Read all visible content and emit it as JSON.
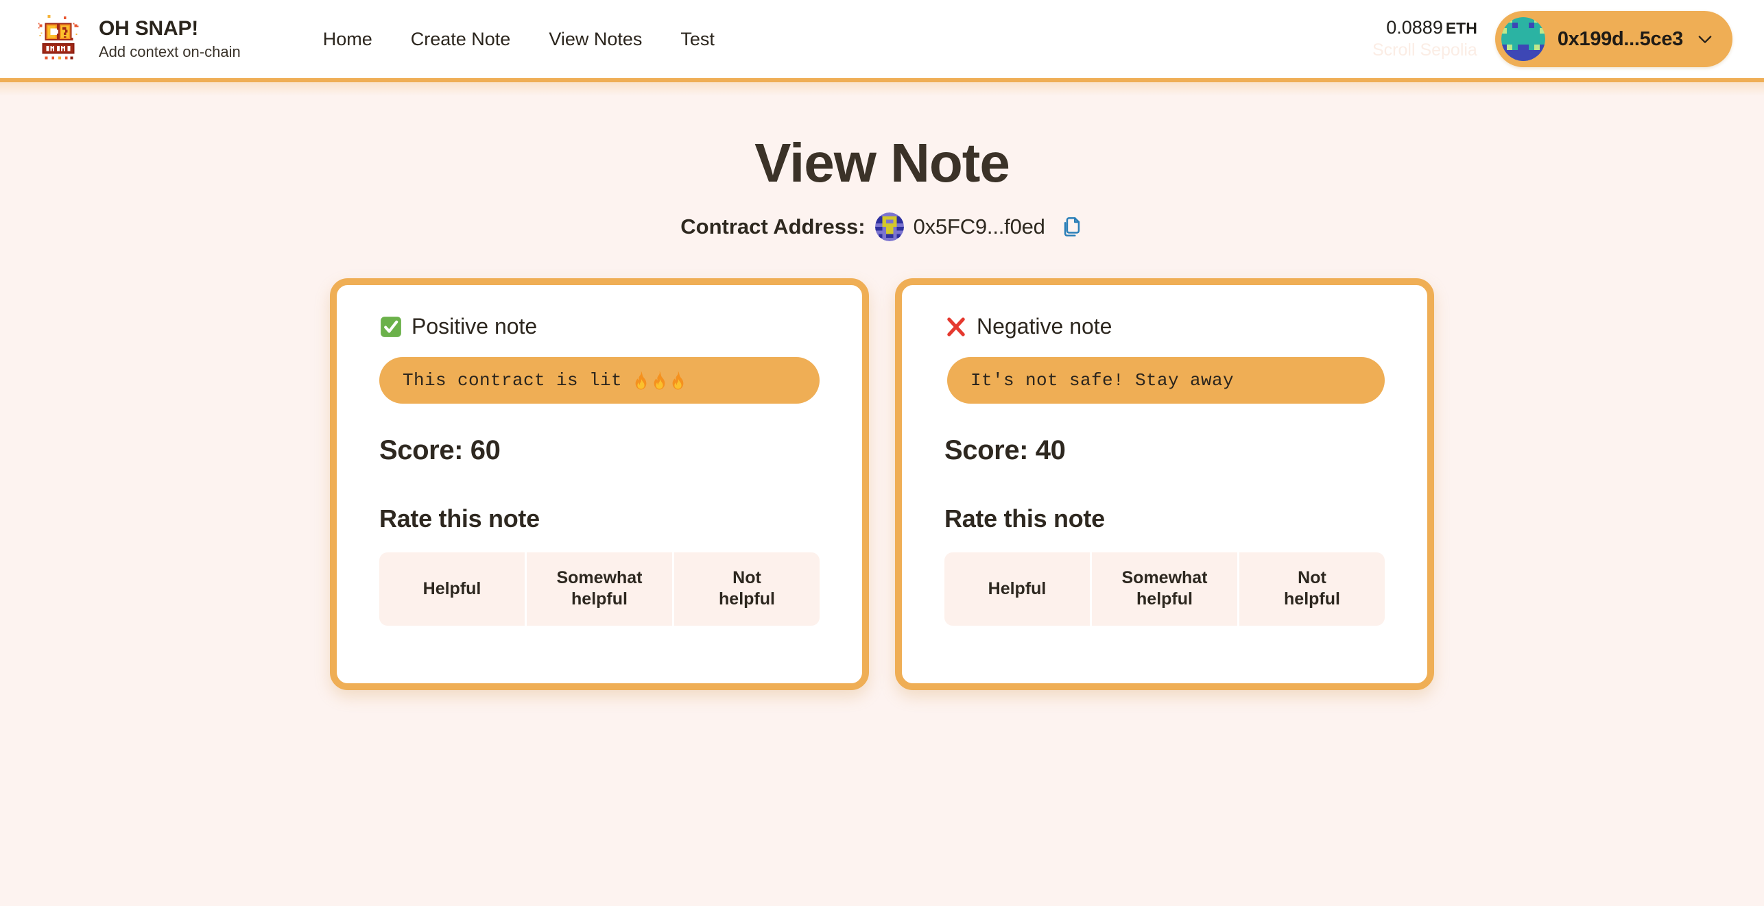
{
  "header": {
    "brand": {
      "title": "OH SNAP!",
      "subtitle": "Add context on-chain",
      "logo_icon": "oh-snap-pixel-logo"
    },
    "nav": [
      {
        "label": "Home"
      },
      {
        "label": "Create Note"
      },
      {
        "label": "View Notes"
      },
      {
        "label": "Test"
      }
    ],
    "wallet": {
      "balance": "0.0889",
      "balance_unit": "ETH",
      "network": "Scroll Sepolia",
      "address": "0x199d...5ce3",
      "avatar_icon": "wallet-blockie-avatar",
      "chevron_icon": "chevron-down-icon"
    }
  },
  "main": {
    "title": "View Note",
    "contract": {
      "label": "Contract Address:",
      "address": "0x5FC9...f0ed",
      "blockie_icon": "contract-blockie-avatar",
      "copy_icon": "copy-icon"
    },
    "cards": [
      {
        "type": "positive",
        "badge_icon": "check-mark-button-icon",
        "heading": "Positive note",
        "note_text": "This contract is lit",
        "note_emoji": "fire",
        "note_emoji_count": 3,
        "score_label": "Score: 60",
        "rate_title": "Rate this note",
        "rate_options": [
          "Helpful",
          "Somewhat\nhelpful",
          "Not\nhelpful"
        ]
      },
      {
        "type": "negative",
        "badge_icon": "cross-mark-icon",
        "heading": "Negative note",
        "note_text": "It's not safe! Stay away",
        "note_emoji": "",
        "note_emoji_count": 0,
        "score_label": "Score: 40",
        "rate_title": "Rate this note",
        "rate_options": [
          "Helpful",
          "Somewhat\nhelpful",
          "Not\nhelpful"
        ]
      }
    ]
  },
  "colors": {
    "accent_orange": "#EFAE55",
    "page_bg": "#FDF3F0",
    "card_bg": "#FFFFFF",
    "text_dark": "#2E2820",
    "positive_green": "#6BB14A",
    "negative_red": "#E5392F",
    "copy_blue": "#2B7FB8"
  }
}
